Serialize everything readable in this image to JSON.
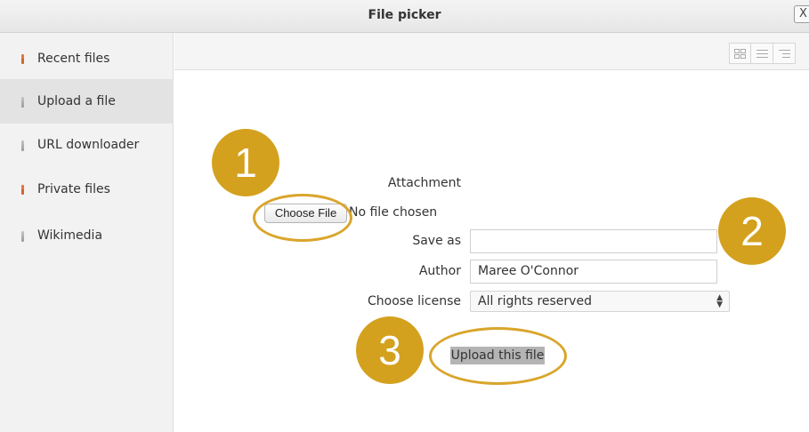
{
  "window": {
    "title": "File picker",
    "close_label": "X"
  },
  "sidebar": {
    "items": [
      {
        "label": "Recent files",
        "icon": "pin-red-icon"
      },
      {
        "label": "Upload a file",
        "icon": "pin-grey-icon",
        "active": true
      },
      {
        "label": "URL downloader",
        "icon": "pin-grey-icon"
      },
      {
        "label": "Private files",
        "icon": "pin-red-icon"
      },
      {
        "label": "Wikimedia",
        "icon": "pin-grey-icon"
      }
    ]
  },
  "toolbar": {
    "view_buttons": [
      "grid-view-icon",
      "list-view-icon",
      "tree-view-icon"
    ]
  },
  "form": {
    "attachment_label": "Attachment",
    "choose_file_label": "Choose File",
    "no_file_text": "No file chosen",
    "save_as_label": "Save as",
    "save_as_value": "",
    "author_label": "Author",
    "author_value": "Maree O'Connor",
    "license_label": "Choose license",
    "license_value": "All rights reserved",
    "upload_label": "Upload this file"
  },
  "annotations": {
    "step1": "1",
    "step2": "2",
    "step3": "3",
    "color": "#d4a11e"
  }
}
